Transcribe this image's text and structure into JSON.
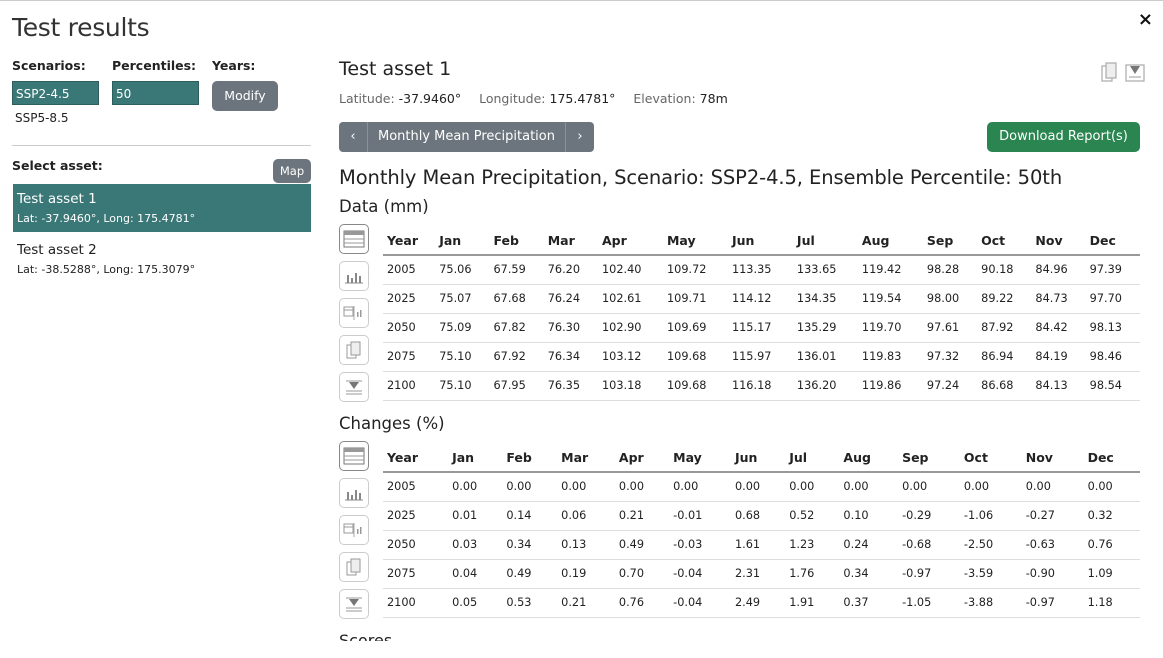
{
  "page": {
    "title": "Test results",
    "close_symbol": "×"
  },
  "filters": {
    "scenarios_label": "Scenarios:",
    "scenarios": [
      "SSP2-4.5",
      "SSP5-8.5"
    ],
    "percentiles_label": "Percentiles:",
    "percentile_value": "50",
    "years_label": "Years:",
    "modify_label": "Modify"
  },
  "assets": {
    "label": "Select asset:",
    "map_label": "Map",
    "items": [
      {
        "name": "Test asset 1",
        "coords": "Lat: -37.9460°, Long: 175.4781°"
      },
      {
        "name": "Test asset 2",
        "coords": "Lat: -38.5288°, Long: 175.3079°"
      }
    ]
  },
  "detail": {
    "asset_title": "Test asset 1",
    "lat_label": "Latitude:",
    "lat_value": "-37.9460°",
    "lon_label": "Longitude:",
    "lon_value": "175.4781°",
    "elev_label": "Elevation:",
    "elev_value": "78m",
    "nav_prev": "‹",
    "nav_title": "Monthly Mean Precipitation",
    "nav_next": "›",
    "download_label": "Download Report(s)",
    "section_title": "Monthly Mean Precipitation, Scenario: SSP2-4.5, Ensemble Percentile: 50th",
    "data_title": "Data (mm)",
    "changes_title": "Changes (%)",
    "cut_title": "Scores"
  },
  "tables": {
    "headers": [
      "Year",
      "Jan",
      "Feb",
      "Mar",
      "Apr",
      "May",
      "Jun",
      "Jul",
      "Aug",
      "Sep",
      "Oct",
      "Nov",
      "Dec"
    ],
    "data_rows": [
      [
        "2005",
        "75.06",
        "67.59",
        "76.20",
        "102.40",
        "109.72",
        "113.35",
        "133.65",
        "119.42",
        "98.28",
        "90.18",
        "84.96",
        "97.39"
      ],
      [
        "2025",
        "75.07",
        "67.68",
        "76.24",
        "102.61",
        "109.71",
        "114.12",
        "134.35",
        "119.54",
        "98.00",
        "89.22",
        "84.73",
        "97.70"
      ],
      [
        "2050",
        "75.09",
        "67.82",
        "76.30",
        "102.90",
        "109.69",
        "115.17",
        "135.29",
        "119.70",
        "97.61",
        "87.92",
        "84.42",
        "98.13"
      ],
      [
        "2075",
        "75.10",
        "67.92",
        "76.34",
        "103.12",
        "109.68",
        "115.97",
        "136.01",
        "119.83",
        "97.32",
        "86.94",
        "84.19",
        "98.46"
      ],
      [
        "2100",
        "75.10",
        "67.95",
        "76.35",
        "103.18",
        "109.68",
        "116.18",
        "136.20",
        "119.86",
        "97.24",
        "86.68",
        "84.13",
        "98.54"
      ]
    ],
    "change_rows": [
      [
        "2005",
        "0.00",
        "0.00",
        "0.00",
        "0.00",
        "0.00",
        "0.00",
        "0.00",
        "0.00",
        "0.00",
        "0.00",
        "0.00",
        "0.00"
      ],
      [
        "2025",
        "0.01",
        "0.14",
        "0.06",
        "0.21",
        "-0.01",
        "0.68",
        "0.52",
        "0.10",
        "-0.29",
        "-1.06",
        "-0.27",
        "0.32"
      ],
      [
        "2050",
        "0.03",
        "0.34",
        "0.13",
        "0.49",
        "-0.03",
        "1.61",
        "1.23",
        "0.24",
        "-0.68",
        "-2.50",
        "-0.63",
        "0.76"
      ],
      [
        "2075",
        "0.04",
        "0.49",
        "0.19",
        "0.70",
        "-0.04",
        "2.31",
        "1.76",
        "0.34",
        "-0.97",
        "-3.59",
        "-0.90",
        "1.09"
      ],
      [
        "2100",
        "0.05",
        "0.53",
        "0.21",
        "0.76",
        "-0.04",
        "2.49",
        "1.91",
        "0.37",
        "-1.05",
        "-3.88",
        "-0.97",
        "1.18"
      ]
    ]
  },
  "colors": {
    "selected": "#3a7777",
    "button_gray": "#6c757d",
    "download_green": "#2a8550"
  },
  "icons": [
    "table-icon",
    "bar-chart-icon",
    "table-chart-icon",
    "copy-icon",
    "download-icon"
  ]
}
